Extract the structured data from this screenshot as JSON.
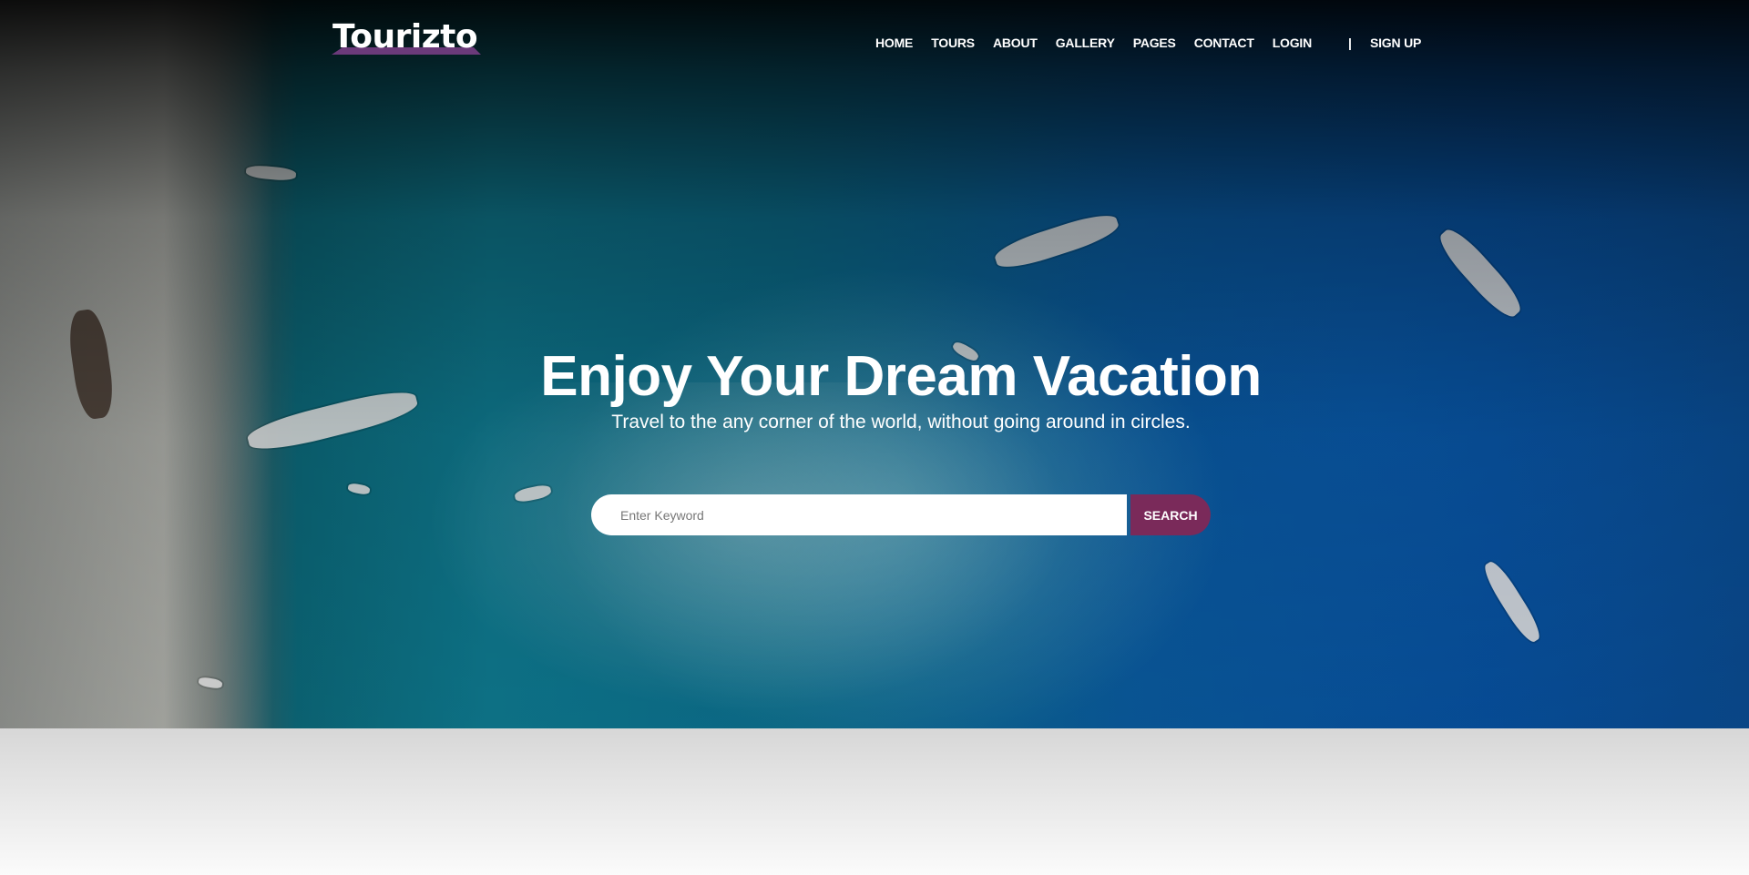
{
  "brand": {
    "logo_text": "Tourizto",
    "accent_color": "#7a2a5a",
    "swoosh_color": "#6b3a7a"
  },
  "nav": {
    "items": [
      {
        "label": "HOME"
      },
      {
        "label": "TOURS"
      },
      {
        "label": "ABOUT"
      },
      {
        "label": "GALLERY"
      },
      {
        "label": "PAGES"
      },
      {
        "label": "CONTACT"
      },
      {
        "label": "LOGIN"
      }
    ],
    "separator": "|",
    "signup_label": "SIGN UP"
  },
  "hero": {
    "title": "Enjoy Your Dream Vacation",
    "subtitle": "Travel to the any corner of the world, without going around in circles.",
    "background": "aerial view of turquoise sea with boats and beach"
  },
  "search": {
    "placeholder": "Enter Keyword",
    "value": "",
    "button_label": "SEARCH"
  }
}
